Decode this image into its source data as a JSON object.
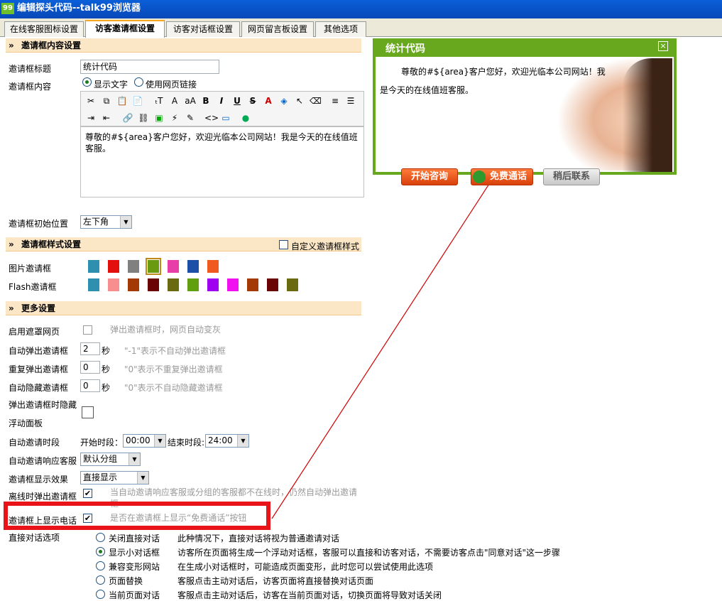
{
  "window": {
    "title": "编辑探头代码--talk99浏览器",
    "app_icon": "99"
  },
  "tabs": [
    {
      "label": "在线客服图标设置"
    },
    {
      "label": "访客邀请框设置"
    },
    {
      "label": "访客对话框设置"
    },
    {
      "label": "网页留言板设置"
    },
    {
      "label": "其他选项"
    }
  ],
  "content_section": {
    "header": "邀请框内容设置",
    "title_label": "邀请框标题",
    "title_value": "统计代码",
    "content_label": "邀请框内容",
    "radio_text": "显示文字",
    "radio_link": "使用网页链接",
    "editor_text": "尊敬的#${area}客户您好，欢迎光临本公司网站！我是今天的在线值班客服。",
    "position_label": "邀请框初始位置",
    "position_value": "左下角"
  },
  "style_section": {
    "header": "邀请框样式设置",
    "custom_label": "自定义邀请框样式",
    "image_label": "图片邀请框",
    "flash_label": "Flash邀请框",
    "image_colors": [
      "#2e8fae",
      "#e30e0e",
      "#808080",
      "#6a9a10",
      "#e83ea8",
      "#1e4fa8",
      "#f05a20"
    ],
    "flash_colors": [
      "#2e8fae",
      "#f78f8f",
      "#a33a06",
      "#6a0404",
      "#6a6a10",
      "#60a010",
      "#a000f0",
      "#f010f0",
      "#a33a06",
      "#6a0404",
      "#6a6a10"
    ]
  },
  "more_section": {
    "header": "更多设置",
    "mask_label": "启用遮罩网页",
    "mask_hint": "弹出邀请框时，网页自动变灰",
    "auto_popup_label": "自动弹出邀请框",
    "auto_popup_value": "2",
    "auto_popup_unit": "秒",
    "auto_popup_hint": "\"-1\"表示不自动弹出邀请框",
    "repeat_label": "重复弹出邀请框",
    "repeat_value": "0",
    "repeat_unit": "秒",
    "repeat_hint": "\"0\"表示不重复弹出邀请框",
    "auto_hide_label": "自动隐藏邀请框",
    "auto_hide_value": "0",
    "auto_hide_unit": "秒",
    "auto_hide_hint": "\"0\"表示不自动隐藏邀请框",
    "hide_float_label_1": "弹出邀请框时隐藏",
    "hide_float_label_2": "浮动面板",
    "period_label": "自动邀请时段",
    "start_label": "开始时段：",
    "start_value": "00:00",
    "end_label": "结束时段:",
    "end_value": "24:00",
    "response_label": "自动邀请响应客服",
    "response_value": "默认分组",
    "effect_label": "邀请框显示效果",
    "effect_value": "直接显示",
    "offline_label": "离线时弹出邀请框",
    "offline_hint": "当自动邀请响应客服或分组的客服都不在线时，仍然自动弹出邀请框",
    "phone_label": "邀请框上显示电话",
    "phone_hint": "是否在邀请框上显示“免费通话”按钮",
    "direct_label": "直接对话选项",
    "direct_options": [
      {
        "label": "关闭直接对话",
        "desc": "此种情况下，直接对话将视为普通邀请对话"
      },
      {
        "label": "显示小对话框",
        "desc": "访客所在页面将生成一个浮动对话框，客服可以直接和访客对话，不需要访客点击\"同意对话\"这一步骤"
      },
      {
        "label": "兼容变形网站",
        "desc": "在生成小对话框时，可能造成页面变形，此时您可以尝试使用此选项"
      },
      {
        "label": "页面替换",
        "desc": "客服点击主动对话后，访客页面将直接替换对话页面"
      },
      {
        "label": "当前页面对话",
        "desc": "客服点击主动对话后，访客在当前页面对话，切换页面将导致对话关闭"
      }
    ],
    "direct_selected": 1
  },
  "preview": {
    "title": "统计代码",
    "text": "尊敬的#${area}客户您好，欢迎光临本公司网站！我是今天的在线值班客服。",
    "btn_start": "开始咨询",
    "btn_call": "免费通话",
    "btn_later": "稍后联系",
    "close_icon": "×"
  },
  "colors": {
    "highlight": "#e8141a",
    "arrow": "#d10000",
    "section_bg": "#fbe6c6",
    "preview_border": "#68a81e"
  }
}
